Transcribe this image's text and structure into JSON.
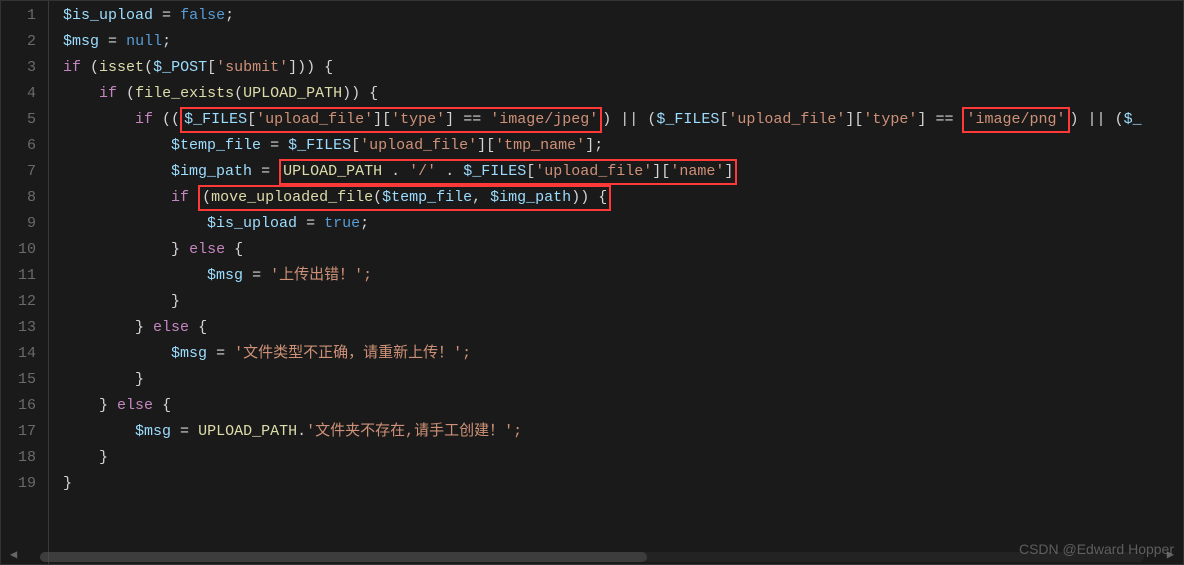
{
  "watermark": "CSDN @Edward Hopper",
  "line_count": 19,
  "tokens": {
    "l1": {
      "v1": "$is_upload",
      "eq": "=",
      "b": "false",
      "semi": ";"
    },
    "l2": {
      "v1": "$msg",
      "eq": "=",
      "b": "null",
      "semi": ";"
    },
    "l3": {
      "k1": "if",
      "p1": "(",
      "f": "isset",
      "p2": "(",
      "v": "$_POST",
      "br1": "[",
      "s": "'submit'",
      "br2": "]))",
      "ob": "{"
    },
    "l4": {
      "k1": "if",
      "p1": "(",
      "f": "file_exists",
      "p2": "(",
      "c": "UPLOAD_PATH",
      "p3": "))",
      "ob": "{"
    },
    "l5": {
      "k1": "if",
      "p1": "((",
      "v1": "$_FILES",
      "b1": "[",
      "s1": "'upload_file'",
      "b2": "][",
      "s2": "'type'",
      "b3": "]",
      "eq1": "==",
      "s3": "'image/jpeg'",
      "cp1": ")",
      "or1": "||",
      "op2": "(",
      "v2": "$_FILES",
      "b4": "[",
      "s4": "'upload_file'",
      "b5": "][",
      "s5": "'type'",
      "b6": "]",
      "eq2": "==",
      "s6": "'image/png'",
      "cp2": ")",
      "or2": "||",
      "op3": "(",
      "v3": "$_"
    },
    "l6": {
      "v1": "$temp_file",
      "eq": "=",
      "v2": "$_FILES",
      "b1": "[",
      "s1": "'upload_file'",
      "b2": "][",
      "s2": "'tmp_name'",
      "b3": "];"
    },
    "l7": {
      "v1": "$img_path",
      "eq": "=",
      "c": "UPLOAD_PATH",
      "dot1": ".",
      "s1": "'/'",
      "dot2": ".",
      "v2": "$_FILES",
      "b1": "[",
      "s2": "'upload_file'",
      "b2": "][",
      "s3": "'name'",
      "b3": "]"
    },
    "l8": {
      "k1": "if",
      "p1": "(",
      "f": "move_uploaded_file",
      "p2": "(",
      "v1": "$temp_file",
      "cm": ",",
      "v2": "$img_path",
      "p3": "))",
      "ob": "{"
    },
    "l9": {
      "v": "$is_upload",
      "eq": "=",
      "b": "true",
      "semi": ";"
    },
    "l10": {
      "cb": "}",
      "k": "else",
      "ob": "{"
    },
    "l11": {
      "v": "$msg",
      "eq": "=",
      "s": "'上传出错！';"
    },
    "l12": {
      "cb": "}"
    },
    "l13": {
      "cb": "}",
      "k": "else",
      "ob": "{"
    },
    "l14": {
      "v": "$msg",
      "eq": "=",
      "s": "'文件类型不正确，请重新上传！';"
    },
    "l15": {
      "cb": "}"
    },
    "l16": {
      "cb": "}",
      "k": "else",
      "ob": "{"
    },
    "l17": {
      "v": "$msg",
      "eq": "=",
      "c": "UPLOAD_PATH",
      "dot": ".",
      "s": "'文件夹不存在,请手工创建！';"
    },
    "l18": {
      "cb": "}"
    },
    "l19": {
      "cb": "}"
    }
  },
  "highlights": [
    "line5-cond1",
    "line5-cond2",
    "line7-path",
    "line8-move"
  ]
}
